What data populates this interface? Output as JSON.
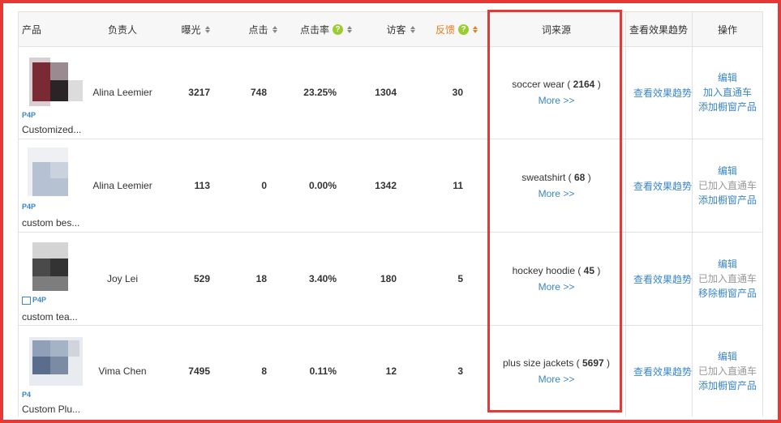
{
  "header": {
    "product": "产品",
    "owner": "负责人",
    "exposure": "曝光",
    "clicks": "点击",
    "ctr": "点击率",
    "visitors": "访客",
    "feedback": "反馈",
    "keyword_source": "词来源",
    "trend": "查看效果趋势",
    "action": "操作",
    "help_glyph": "?"
  },
  "rows": [
    {
      "badge": "P4P",
      "product_name": "Customized...",
      "owner": "Alina Leemier",
      "exposure": "3217",
      "clicks": "748",
      "ctr": "23.25%",
      "visitors": "1304",
      "feedback": "30",
      "keyword": "soccer wear",
      "keyword_count": "2164",
      "more": "More >>",
      "trend": "查看效果趋势",
      "edit": "编辑",
      "action2": "加入直通车",
      "action3": "添加橱窗产品"
    },
    {
      "badge": "P4P",
      "product_name": "custom bes...",
      "owner": "Alina Leemier",
      "exposure": "113",
      "clicks": "0",
      "ctr": "0.00%",
      "visitors": "1342",
      "feedback": "11",
      "keyword": "sweatshirt",
      "keyword_count": "68",
      "more": "More >>",
      "trend": "查看效果趋势",
      "edit": "编辑",
      "action2": "已加入直通车",
      "action3": "添加橱窗产品"
    },
    {
      "badge": "P4P",
      "product_name": "custom tea...",
      "owner": "Joy Lei",
      "exposure": "529",
      "clicks": "18",
      "ctr": "3.40%",
      "visitors": "180",
      "feedback": "5",
      "keyword": "hockey hoodie",
      "keyword_count": "45",
      "more": "More >>",
      "trend": "查看效果趋势",
      "edit": "编辑",
      "action2": "已加入直通车",
      "action3": "移除橱窗产品"
    },
    {
      "badge": "P4",
      "product_name": "Custom Plu...",
      "owner": "Vima Chen",
      "exposure": "7495",
      "clicks": "8",
      "ctr": "0.11%",
      "visitors": "12",
      "feedback": "3",
      "keyword": "plus size jackets",
      "keyword_count": "5697",
      "more": "More >>",
      "trend": "查看效果趋势",
      "edit": "编辑",
      "action2": "已加入直通车",
      "action3": "添加橱窗产品"
    }
  ],
  "colors": {
    "link": "#3a86c8",
    "highlight_border": "#e53935",
    "feedback_header": "#e67e22",
    "muted": "#999999"
  }
}
